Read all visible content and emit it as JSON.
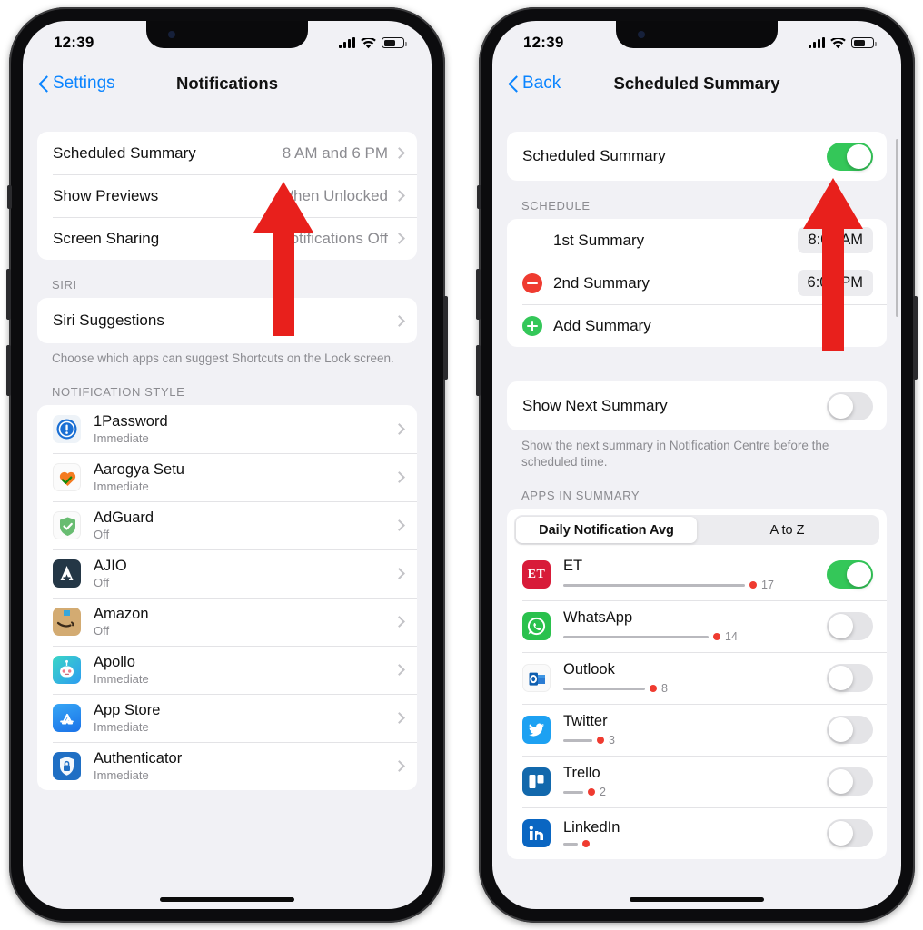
{
  "theme": {
    "accent_blue": "#0a84ff",
    "toggle_on_green": "#34c759",
    "destructive_red": "#ef3b30",
    "arrow_red": "#e8201c",
    "secondary_text": "#8b8b90",
    "screen_bg": "#f1f1f5",
    "card_bg": "#ffffff"
  },
  "left_phone": {
    "status_bar": {
      "time": "12:39",
      "signal_icon": "cellular-bars-icon",
      "wifi_icon": "wifi-icon",
      "battery_icon": "battery-icon",
      "battery_level": 55
    },
    "nav": {
      "back_label": "Settings",
      "back_icon": "chevron-left-icon",
      "title": "Notifications"
    },
    "main_group": [
      {
        "label": "Scheduled Summary",
        "value": "8 AM and 6 PM",
        "accessory": "chevron-right-icon"
      },
      {
        "label": "Show Previews",
        "value": "When Unlocked",
        "accessory": "chevron-right-icon"
      },
      {
        "label": "Screen Sharing",
        "value": "Notifications Off",
        "accessory": "chevron-right-icon"
      }
    ],
    "siri_section": {
      "header": "SIRI",
      "row": {
        "label": "Siri Suggestions",
        "accessory": "chevron-right-icon"
      },
      "footnote": "Choose which apps can suggest Shortcuts on the Lock screen."
    },
    "notification_style": {
      "header": "NOTIFICATION STYLE",
      "apps": [
        {
          "name": "1Password",
          "status": "Immediate",
          "icon": "1password-icon"
        },
        {
          "name": "Aarogya Setu",
          "status": "Immediate",
          "icon": "aarogya-setu-icon"
        },
        {
          "name": "AdGuard",
          "status": "Off",
          "icon": "adguard-icon"
        },
        {
          "name": "AJIO",
          "status": "Off",
          "icon": "ajio-icon"
        },
        {
          "name": "Amazon",
          "status": "Off",
          "icon": "amazon-icon"
        },
        {
          "name": "Apollo",
          "status": "Immediate",
          "icon": "apollo-icon"
        },
        {
          "name": "App Store",
          "status": "Immediate",
          "icon": "app-store-icon"
        },
        {
          "name": "Authenticator",
          "status": "Immediate",
          "icon": "authenticator-icon"
        }
      ]
    }
  },
  "right_phone": {
    "status_bar": {
      "time": "12:39",
      "signal_icon": "cellular-bars-icon",
      "wifi_icon": "wifi-icon",
      "battery_icon": "battery-icon",
      "battery_level": 55
    },
    "nav": {
      "back_label": "Back",
      "back_icon": "chevron-left-icon",
      "title": "Scheduled Summary"
    },
    "master_toggle": {
      "label": "Scheduled Summary",
      "state": "on"
    },
    "schedule": {
      "header": "SCHEDULE",
      "items": [
        {
          "label": "1st Summary",
          "time": "8:00 AM",
          "action": "none"
        },
        {
          "label": "2nd Summary",
          "time": "6:00 PM",
          "action": "remove"
        }
      ],
      "add_row": {
        "label": "Add Summary",
        "action": "add"
      }
    },
    "show_next": {
      "label": "Show Next Summary",
      "state": "off",
      "footnote": "Show the next summary in Notification Centre before the scheduled time."
    },
    "apps_in_summary": {
      "header": "APPS IN SUMMARY",
      "segmented": {
        "options": [
          "Daily Notification Avg",
          "A to Z"
        ],
        "selected": "Daily Notification Avg"
      },
      "apps": [
        {
          "name": "ET",
          "count": "17",
          "toggle": "on",
          "icon": "et-icon",
          "bar_pct": 100
        },
        {
          "name": "WhatsApp",
          "count": "14",
          "toggle": "off",
          "icon": "whatsapp-icon",
          "bar_pct": 82
        },
        {
          "name": "Outlook",
          "count": "8",
          "toggle": "off",
          "icon": "outlook-icon",
          "bar_pct": 47
        },
        {
          "name": "Twitter",
          "count": "3",
          "toggle": "off",
          "icon": "twitter-icon",
          "bar_pct": 18
        },
        {
          "name": "Trello",
          "count": "2",
          "toggle": "off",
          "icon": "trello-icon",
          "bar_pct": 12
        },
        {
          "name": "LinkedIn",
          "count": "",
          "toggle": "off",
          "icon": "linkedin-icon",
          "bar_pct": 8
        }
      ]
    }
  },
  "annotations": {
    "left_arrow": {
      "shape": "up-arrow",
      "color": "#e8201c",
      "points_at": "Scheduled Summary row"
    },
    "right_arrow": {
      "shape": "up-arrow",
      "color": "#e8201c",
      "points_at": "Scheduled Summary toggle"
    }
  }
}
